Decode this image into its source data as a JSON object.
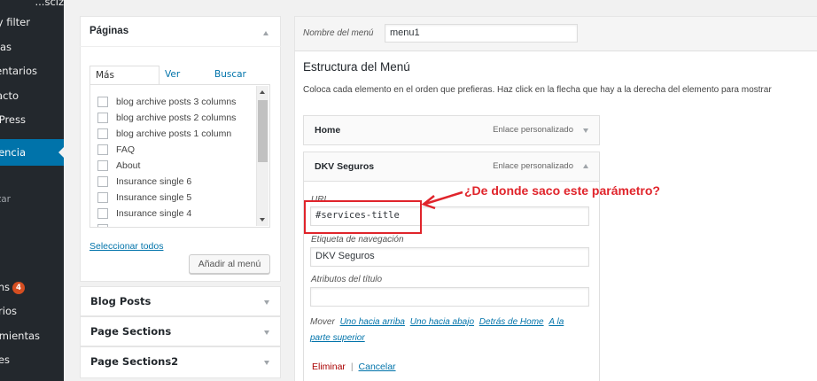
{
  "sidebar": {
    "items": [
      {
        "label": "...sciz"
      },
      {
        "label": "ry filter"
      },
      {
        "label": "as"
      },
      {
        "label": "entarios"
      },
      {
        "label": "acto"
      },
      {
        "label": "Press"
      },
      {
        "label": "encia"
      },
      {
        "label": "zar"
      },
      {
        "label": "ns",
        "badge": "4"
      },
      {
        "label": "rios"
      },
      {
        "label": "mientas"
      },
      {
        "label": "es"
      }
    ]
  },
  "paginas": {
    "title": "Páginas",
    "tabs": [
      "Más reciente",
      "Ver todo",
      "Buscar"
    ],
    "items": [
      "blog archive posts 3 columns",
      "blog archive posts 2 columns",
      "blog archive posts 1 column",
      "FAQ",
      "About",
      "Insurance single 6",
      "Insurance single 5",
      "Insurance single 4"
    ],
    "select_all": "Seleccionar todos",
    "add_button": "Añadir al menú"
  },
  "accordion": [
    {
      "title": "Blog Posts"
    },
    {
      "title": "Page Sections"
    },
    {
      "title": "Page Sections2"
    }
  ],
  "menu_editor": {
    "name_label": "Nombre del menú",
    "name_value": "menu1",
    "structure_title": "Estructura del Menú",
    "structure_desc": "Coloca cada elemento en el orden que prefieras. Haz click en la flecha que hay a la derecha del elemento para mostrar",
    "items": [
      {
        "title": "Home",
        "type": "Enlace personalizado"
      },
      {
        "title": "DKV Seguros",
        "type": "Enlace personalizado"
      }
    ],
    "url_label": "URL",
    "url_value": "#services-title",
    "nav_label": "Etiqueta de navegación",
    "nav_value": "DKV Seguros",
    "attr_label": "Atributos del título",
    "attr_value": "",
    "move_label": "Mover",
    "move_links": [
      "Uno hacia arriba",
      "Uno hacia abajo",
      "Detrás de Home",
      "A la parte superior"
    ],
    "delete": "Eliminar",
    "separator": "|",
    "cancel": "Cancelar"
  },
  "annotation": {
    "text": "¿De donde saco este parámetro?",
    "color": "#e0242b"
  },
  "colors": {
    "sidebar_bg": "#23282d",
    "accent": "#0073aa",
    "badge": "#d54e21",
    "annotation": "#e0242b"
  }
}
